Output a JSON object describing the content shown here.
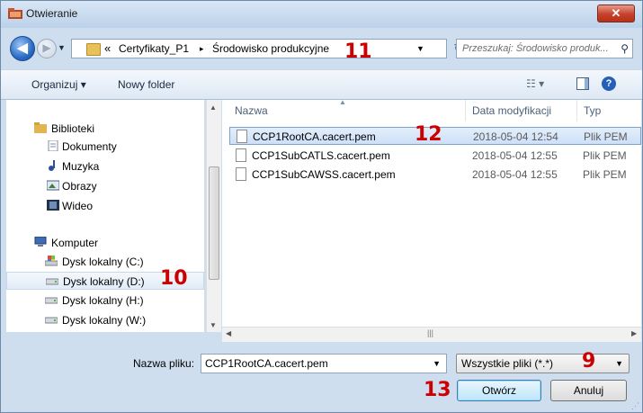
{
  "window": {
    "title": "Otwieranie",
    "close_label": "✕"
  },
  "address": {
    "chevrons": "«",
    "segments": [
      "Certyfikaty_P1",
      "Środowisko produkcyjne"
    ],
    "separator": "▸",
    "search_placeholder": "Przeszukaj: Środowisko produk..."
  },
  "toolbar": {
    "organize_label": "Organizuj ▾",
    "new_folder_label": "Nowy folder"
  },
  "sidebar": {
    "libraries_label": "Biblioteki",
    "libraries": [
      "Dokumenty",
      "Muzyka",
      "Obrazy",
      "Wideo"
    ],
    "computer_label": "Komputer",
    "drives": [
      "Dysk lokalny (C:)",
      "Dysk lokalny (D:)",
      "Dysk lokalny (H:)",
      "Dysk lokalny (W:)"
    ],
    "selected_drive": "Dysk lokalny (D:)"
  },
  "file_list": {
    "columns": [
      "Nazwa",
      "Data modyfikacji",
      "Typ"
    ],
    "rows": [
      {
        "name": "CCP1RootCA.cacert.pem",
        "date": "2018-05-04 12:54",
        "type": "Plik PEM"
      },
      {
        "name": "CCP1SubCATLS.cacert.pem",
        "date": "2018-05-04 12:55",
        "type": "Plik PEM"
      },
      {
        "name": "CCP1SubCAWSS.cacert.pem",
        "date": "2018-05-04 12:55",
        "type": "Plik PEM"
      }
    ],
    "selected_row": "CCP1RootCA.cacert.pem"
  },
  "bottom": {
    "filename_label": "Nazwa pliku:",
    "filename_value": "CCP1RootCA.cacert.pem",
    "filter_value": "Wszystkie pliki (*.*)",
    "open_label": "Otwórz",
    "cancel_label": "Anuluj"
  },
  "callouts": {
    "address": "11",
    "file": "12",
    "drive": "10",
    "filter": "9",
    "open": "13"
  },
  "icons": [
    "folder-icon",
    "back-arrow-icon",
    "forward-arrow-icon",
    "refresh-icon",
    "search-icon",
    "view-icon",
    "preview-pane-icon",
    "help-icon",
    "library-icon",
    "document-icon",
    "music-icon",
    "pictures-icon",
    "video-icon",
    "computer-icon",
    "drive-icon",
    "file-icon"
  ],
  "colors": {
    "accent": "#2460b8",
    "callout": "#cc0000",
    "selection": "#cde0f7",
    "frame": "#cfdeef"
  }
}
